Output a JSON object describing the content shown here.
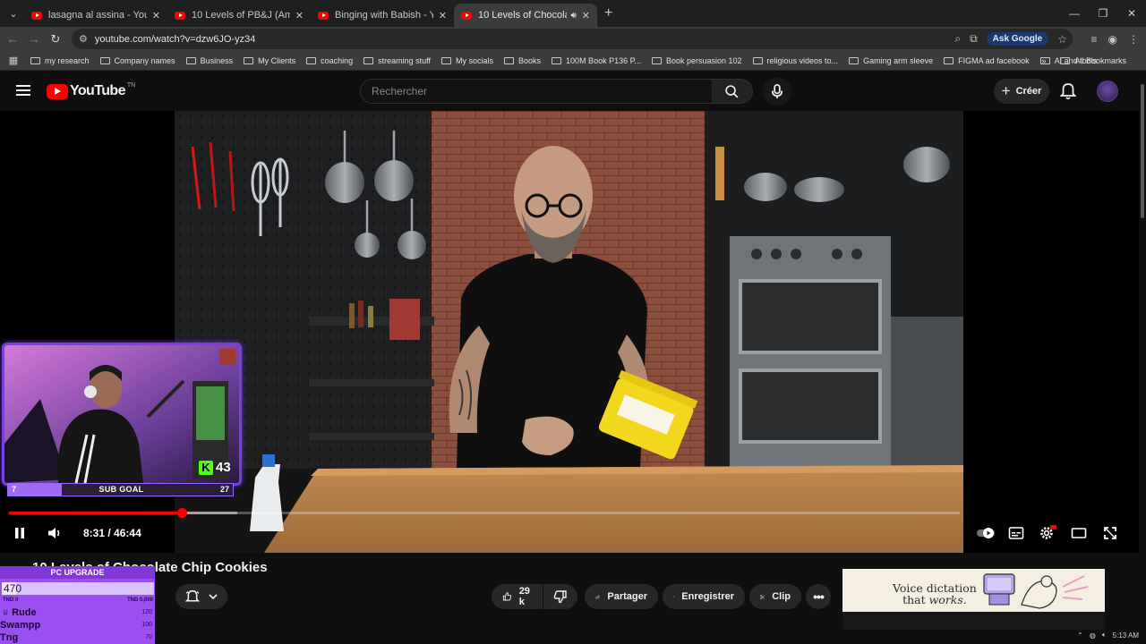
{
  "browser": {
    "tabs": [
      {
        "title": "lasagna al assina - YouTube",
        "active": false
      },
      {
        "title": "10 Levels of PB&J (Amateur to",
        "active": false
      },
      {
        "title": "Binging with Babish - YouTube",
        "active": false
      },
      {
        "title": "10 Levels of Chocolate Chip",
        "active": true
      }
    ],
    "url": "youtube.com/watch?v=dzw6JO-yz34",
    "ask_google": "Ask Google",
    "bookmarks": [
      "my research",
      "Company names",
      "Business",
      "My Clients",
      "coaching",
      "streaming stuff",
      "My socials",
      "Books",
      "100M Book P136 P...",
      "Book persuasion 102",
      "religious videos to...",
      "Gaming arm sleeve",
      "FIGMA ad facebook",
      "AI and tools"
    ],
    "all_bookmarks": "All Bookmarks"
  },
  "youtube": {
    "logo": "YouTube",
    "logo_tn": "TN",
    "search_placeholder": "Rechercher",
    "create_label": "Créer"
  },
  "player": {
    "current_time": "8:31",
    "duration": "46:44",
    "progress_fraction": 0.182,
    "buffered_fraction": 0.24
  },
  "video": {
    "title": "10 Levels of Chocolate Chip Cookies",
    "likes": "29 k",
    "share_label": "Partager",
    "save_label": "Enregistrer",
    "clip_label": "Clip"
  },
  "ad": {
    "line1": "Voice dictation",
    "line2_plain": "that",
    "line2_italic": "works."
  },
  "overlay": {
    "kick_count": "43",
    "sub_goal": {
      "label": "SUB GOAL",
      "current": "7",
      "target": "27"
    },
    "pc_upgrade": {
      "title": "PC UPGRADE",
      "value": "470",
      "fill_fraction": 0.094,
      "min_label": "TND 0",
      "max_label": "TND 5,000",
      "donors": [
        {
          "name": "Rude",
          "amount": "120"
        },
        {
          "name": "Swampp",
          "amount": "100"
        },
        {
          "name": "Tng",
          "amount": "70"
        }
      ]
    }
  },
  "taskbar": {
    "time": "5:13 AM"
  },
  "colors": {
    "accent": "#ff0000",
    "overlay_purple": "#9c4ff0",
    "kick_green": "#53fc18"
  }
}
